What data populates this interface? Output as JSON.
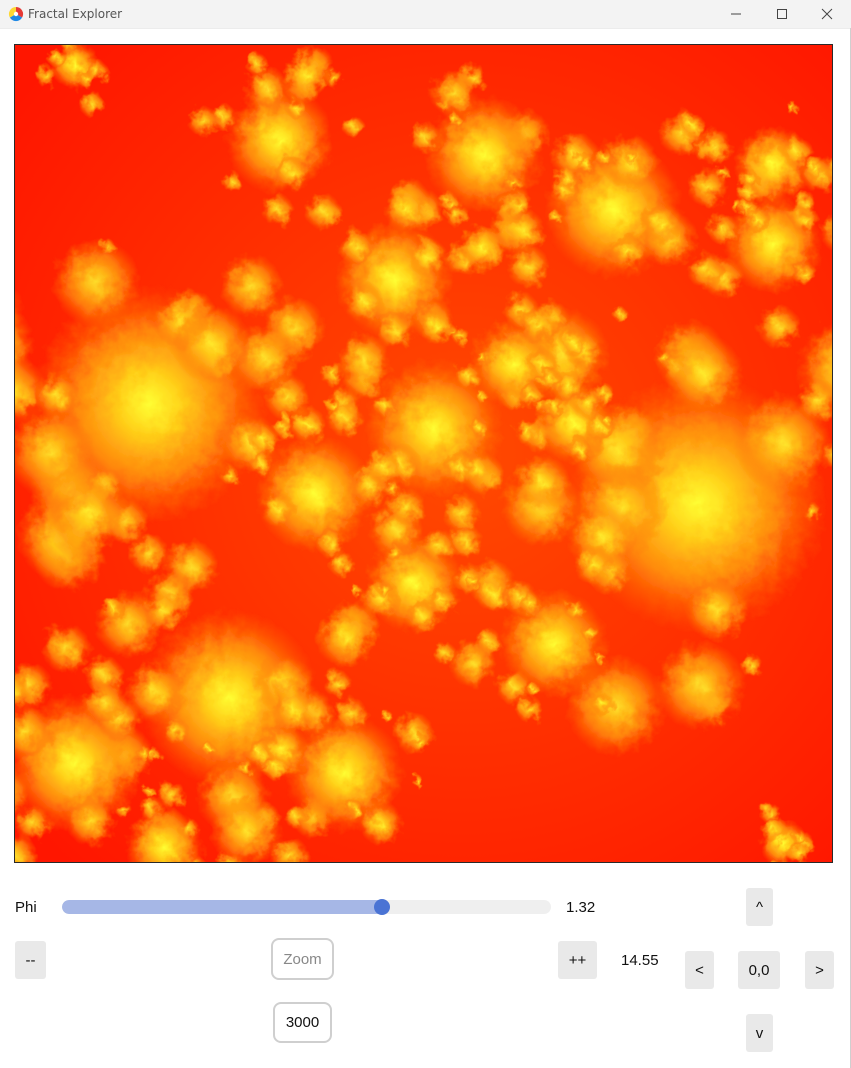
{
  "window": {
    "title": "Fractal Explorer",
    "app_icon": "color-wheel-icon",
    "controls": [
      "minimize-icon",
      "maximize-icon",
      "close-icon"
    ]
  },
  "fractal": {
    "type": "julia-set",
    "colors": {
      "background": "#ff1a00",
      "mid": "#ff9a1a",
      "core": "#ffff00"
    }
  },
  "controls": {
    "phi_label": "Phi",
    "phi_value": "1.32",
    "phi_slider_fraction": 0.655,
    "decrease_label": "--",
    "increase_label": "++",
    "zoom_placeholder": "Zoom",
    "zoom_value": "14.55",
    "iterations_value": "3000",
    "pan": {
      "up_label": "^",
      "down_label": "v",
      "left_label": "<",
      "right_label": ">",
      "center_label": "0,0"
    }
  }
}
